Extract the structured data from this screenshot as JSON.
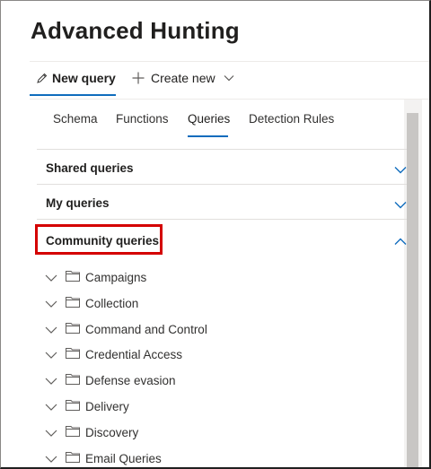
{
  "page": {
    "title": "Advanced Hunting"
  },
  "commandbar": {
    "new_query_label": "New query",
    "new_query_icon": "edit-icon",
    "create_new_label": "Create new",
    "create_new_icon": "plus-icon"
  },
  "tabs": [
    {
      "label": "Schema",
      "active": false
    },
    {
      "label": "Functions",
      "active": false
    },
    {
      "label": "Queries",
      "active": true
    },
    {
      "label": "Detection Rules",
      "active": false
    }
  ],
  "sections": [
    {
      "label": "Shared queries",
      "expanded": false
    },
    {
      "label": "My queries",
      "expanded": false
    },
    {
      "label": "Community queries",
      "expanded": true,
      "highlighted": true
    }
  ],
  "community_items": [
    {
      "label": "Campaigns"
    },
    {
      "label": "Collection"
    },
    {
      "label": "Command and Control"
    },
    {
      "label": "Credential Access"
    },
    {
      "label": "Defense evasion"
    },
    {
      "label": "Delivery"
    },
    {
      "label": "Discovery"
    },
    {
      "label": "Email Queries"
    }
  ],
  "colors": {
    "accent": "#0f6cbd",
    "highlight_box": "#d40000",
    "chevron": "#0f6cbd"
  }
}
